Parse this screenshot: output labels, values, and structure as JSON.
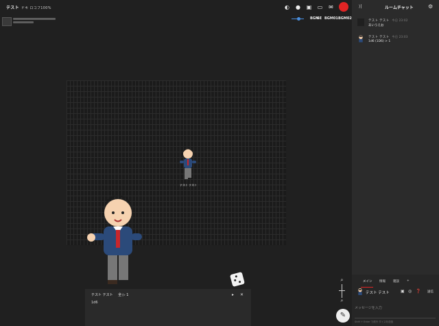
{
  "topbar": {
    "room_name": "テスト",
    "room_caption": "ドキ ロコフ100%",
    "icons": [
      "dice-icon",
      "volume-icon",
      "image-icon",
      "screen-icon",
      "mail-icon"
    ],
    "record_color": "#e02424"
  },
  "member": {
    "avatar_icon": "user-avatar-icon"
  },
  "controls": {
    "labels": [
      "BGM",
      "SE",
      "BGM01",
      "BGM02"
    ]
  },
  "board": {
    "piece_label": "テスト テスト"
  },
  "palette": {
    "speaker": "テスト テスト",
    "target": "全 ▷ 1",
    "line": "1d6",
    "minimize_icon": "▸",
    "close_icon": "✕"
  },
  "zoom": {
    "zoom_in_icon": "🔍",
    "zoom_out_icon": "🔍",
    "pen_icon": "✎"
  },
  "sidebar": {
    "collapse_icon": "⟩|",
    "title": "ルームチャット",
    "messages": [
      {
        "name": "テスト テスト",
        "time": "今日 23:02",
        "text": "あいうえお"
      },
      {
        "name": "テスト テスト",
        "time": "今日 23:03",
        "text": "1d6 (1D6) > 1"
      }
    ],
    "tabs": [
      "メイン",
      "情報",
      "雑談",
      "+"
    ],
    "speaker_name": "テスト テスト",
    "send_label": "送信",
    "input_placeholder": "メッセージを入力",
    "footer": "Shift + Enter で改行 ダイスを送信"
  }
}
